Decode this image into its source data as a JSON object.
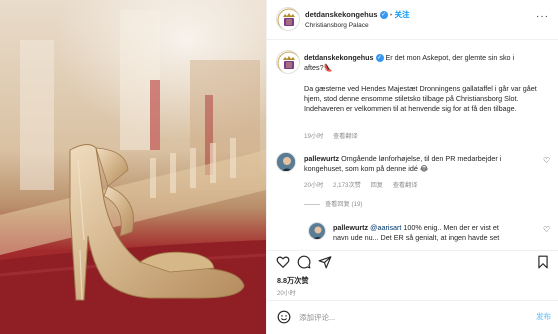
{
  "colors": {
    "accent": "#0095f6",
    "verified": "#3897f0",
    "muted": "#8e8e8e"
  },
  "header": {
    "username": "detdanskekongehus",
    "separator": "•",
    "follow_label": "关注",
    "location": "Christiansborg Palace",
    "more_icon": "more-dots-icon"
  },
  "caption": {
    "username": "detdanskekongehus",
    "line1": "Er det mon Askepot, der glemte sin sko i",
    "line2": "aftes?👠",
    "body": "Da gæsterne ved Hendes Majestæt Dronningens gallataffel i går var gået hjem, stod denne ensomme stiletsko tilbage på Christiansborg Slot. Indehaveren er velkommen til at henvende sig for at få den tilbage.",
    "time": "19小时",
    "translate": "查看翻译"
  },
  "comments": [
    {
      "username": "pallewurtz",
      "text": "Omgående lønforhøjelse, til den PR medarbejder i kongehuset, som kom på denne idé 😂",
      "time": "20小时",
      "likes": "2,173次赞",
      "reply": "回复",
      "translate": "查看翻译",
      "replies_label": "查看回复 (19)"
    },
    {
      "username": "pallewurtz",
      "mention": "@aarisart",
      "text_line1": "100% enig.. Men der er vist et",
      "text_line2": "navn ude nu... Det ER så genialt, at ingen havde set"
    }
  ],
  "actions": {
    "like_icon": "heart-icon",
    "comment_icon": "comment-icon",
    "share_icon": "send-icon",
    "save_icon": "bookmark-icon"
  },
  "likes": "8.8万次赞",
  "timestamp": "20小时",
  "comment_box": {
    "placeholder": "添加评论...",
    "emoji_icon": "emoji-icon",
    "post_label": "发布"
  }
}
